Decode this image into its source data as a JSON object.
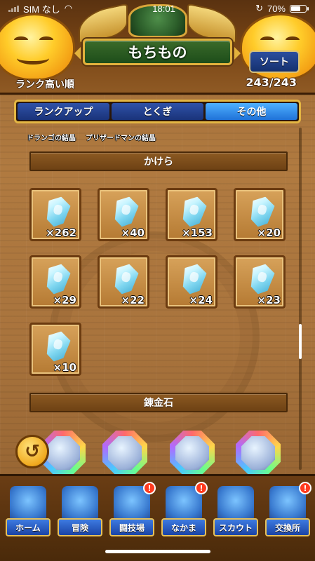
{
  "status_bar": {
    "carrier": "SIM なし",
    "time": "18:01",
    "battery_text": "70%",
    "battery_level": 0.7
  },
  "header": {
    "title": "もちもの",
    "sort_button": "ソート",
    "sort_order": "ランク高い順",
    "item_count": "243/243"
  },
  "tabs": [
    {
      "label": "ランクアップ",
      "active": false
    },
    {
      "label": "とくぎ",
      "active": false
    },
    {
      "label": "その他",
      "active": true
    }
  ],
  "previous_items": [
    "ドランゴの結晶",
    "プリザードマンの結晶"
  ],
  "sections": {
    "fragments": "かけら",
    "alchemy": "錬金石"
  },
  "fragments": [
    {
      "qty": "×262"
    },
    {
      "qty": "×40"
    },
    {
      "qty": "×153"
    },
    {
      "qty": "×20"
    },
    {
      "qty": "×29"
    },
    {
      "qty": "×22"
    },
    {
      "qty": "×24"
    },
    {
      "qty": "×23"
    },
    {
      "qty": "×10"
    }
  ],
  "bottom_nav": [
    {
      "label": "ホーム",
      "alert": false,
      "icon": "tent-icon"
    },
    {
      "label": "冒険",
      "alert": false,
      "icon": "wagon-icon"
    },
    {
      "label": "闘技場",
      "alert": true,
      "icon": "arena-icon"
    },
    {
      "label": "なかま",
      "alert": true,
      "icon": "party-icon"
    },
    {
      "label": "スカウト",
      "alert": false,
      "icon": "scout-icon"
    },
    {
      "label": "交換所",
      "alert": true,
      "icon": "exchange-icon"
    }
  ],
  "alert_mark": "!"
}
